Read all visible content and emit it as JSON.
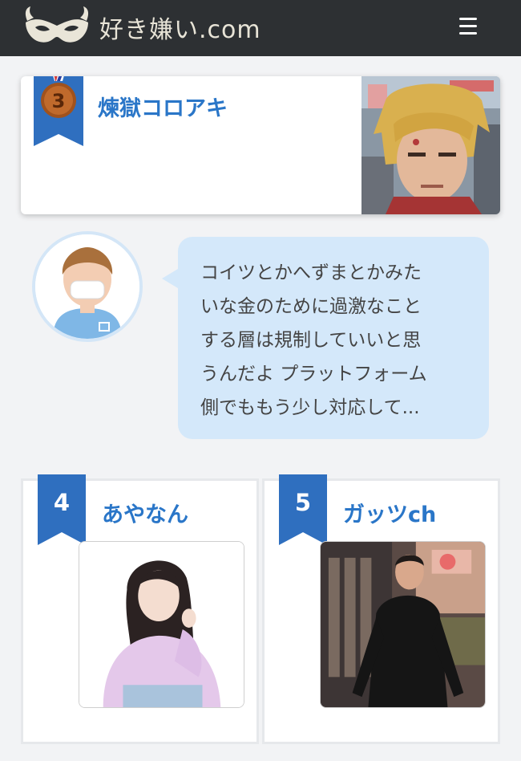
{
  "header": {
    "site_name": "好き嫌い.com",
    "logo_icon": "mask-icon",
    "menu_icon": "hamburger-menu-icon",
    "bg_color": "#2d3033"
  },
  "ranking": {
    "third": {
      "rank": "3",
      "name": "煉獄コロアキ",
      "medal_icon": "bronze-medal-icon"
    },
    "comment": {
      "text": "コイツとかへずまとかみたいな金のために過激なことする層は規制していいと思うんだよ プラットフォーム側でももう少し対応して...",
      "lines": [
        "コイツとかへずまとかみた",
        "いな金のために過激なこと",
        "する層は規制していいと思",
        "うんだよ プラットフォーム",
        "側でももう少し対応して..."
      ],
      "avatar_icon": "user-avatar-icon"
    },
    "items": [
      {
        "rank": "4",
        "name": "あやなん"
      },
      {
        "rank": "5",
        "name": "ガッツch"
      }
    ]
  },
  "colors": {
    "accent": "#2a76c8",
    "badge_blue": "#2f6fbf",
    "bubble": "#d4e8fa",
    "bronze": "#b8642a"
  }
}
